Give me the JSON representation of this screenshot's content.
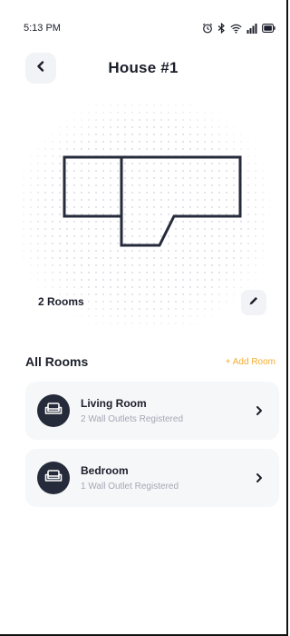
{
  "status_bar": {
    "time": "5:13 PM",
    "icons": [
      "alarm-icon",
      "bluetooth-icon",
      "wifi-icon",
      "signal-icon",
      "battery-icon"
    ]
  },
  "header": {
    "back_icon": "chevron-left-icon",
    "title": "House #1"
  },
  "floor_plan": {
    "rooms_label": "2 Rooms",
    "edit_icon": "pencil-icon"
  },
  "rooms_section": {
    "title": "All Rooms",
    "add_label": "+ Add Room",
    "rooms": [
      {
        "name": "Living Room",
        "subtitle": "2 Wall Outlets Registered",
        "icon": "sofa-icon"
      },
      {
        "name": "Bedroom",
        "subtitle": "1 Wall Outlet Registered",
        "icon": "sofa-icon"
      }
    ]
  },
  "colors": {
    "text": "#1c1f2b",
    "accent": "#f5ad2f",
    "card_bg": "#f6f7f9",
    "icon_badge": "#262b3b",
    "muted": "#a4a8b4"
  }
}
